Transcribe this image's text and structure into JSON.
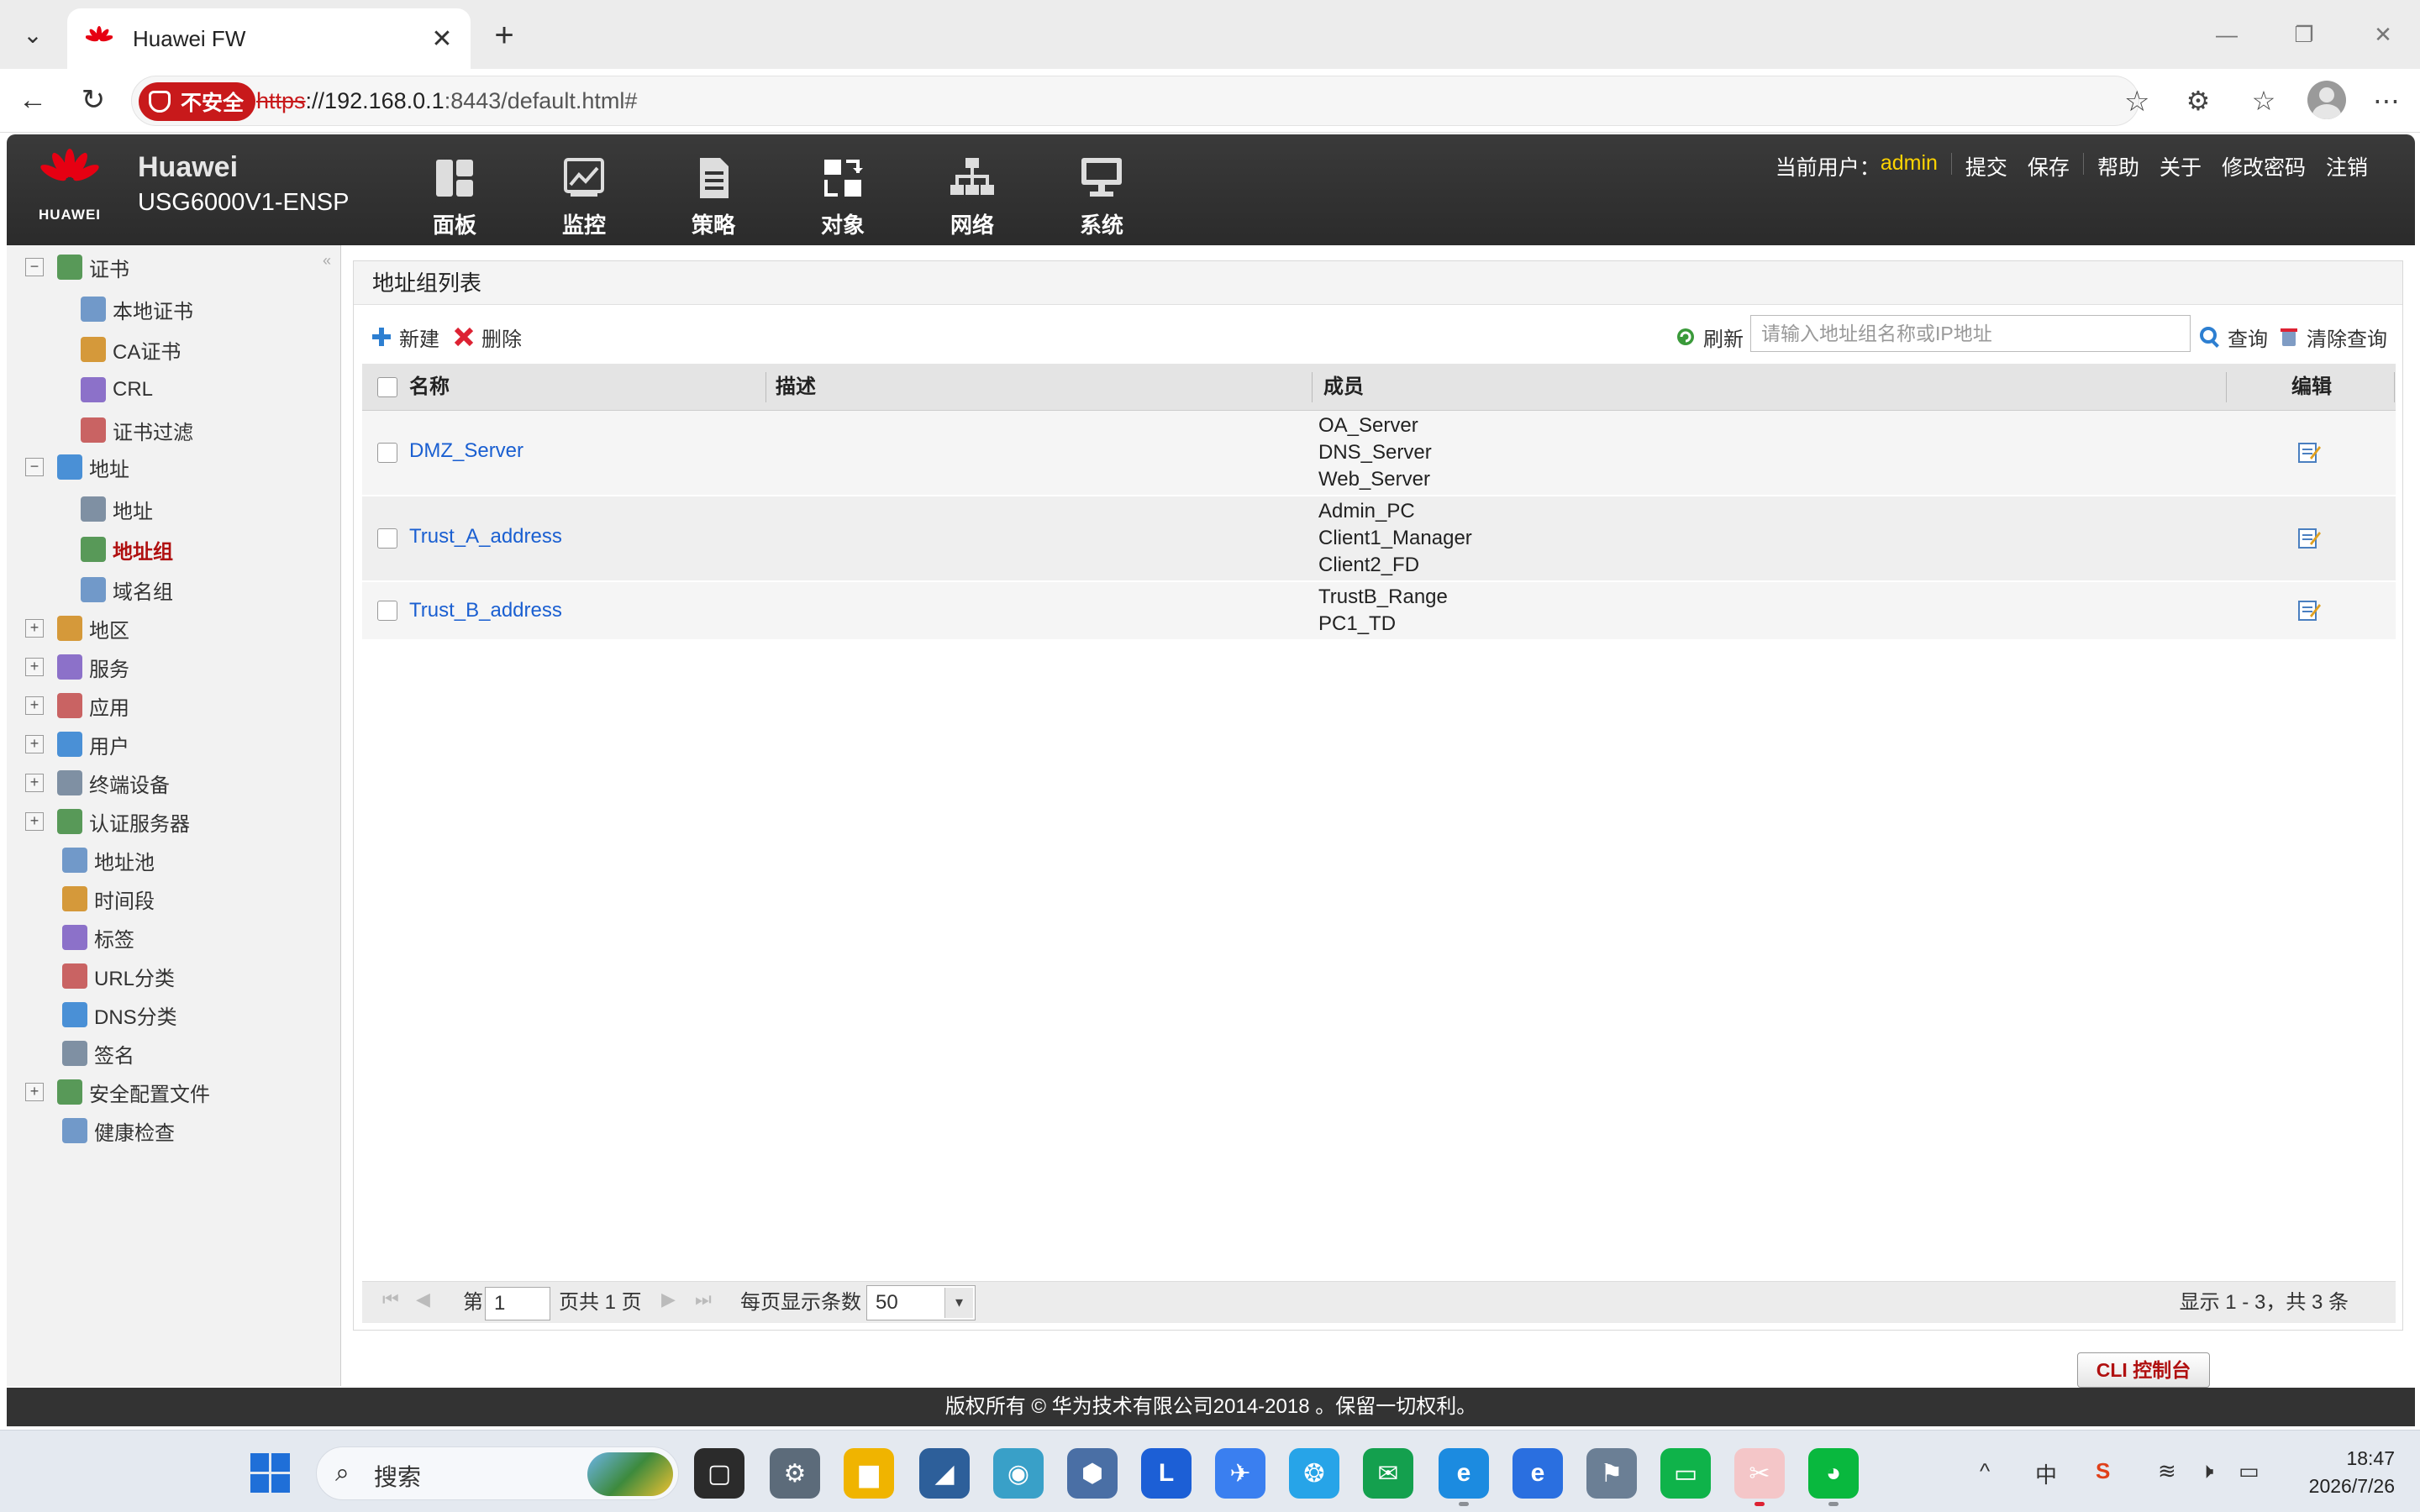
{
  "browser": {
    "tab_title": "Huawei FW",
    "insecure_label": "不安全",
    "url_scheme": "https",
    "url_host": "://192.168.0.1",
    "url_rest": ":8443/default.html#"
  },
  "app": {
    "logo_text": "HUAWEI",
    "brand_line1": "Huawei",
    "brand_line2": "USG6000V1-ENSP",
    "menu": [
      "面板",
      "监控",
      "策略",
      "对象",
      "网络",
      "系统"
    ],
    "active_menu": "对象",
    "current_user_label": "当前用户：",
    "current_user": "admin",
    "links": [
      "提交",
      "保存",
      "帮助",
      "关于",
      "修改密码",
      "注销"
    ]
  },
  "sidebar": {
    "items": [
      {
        "label": "证书",
        "toggle": "−"
      },
      {
        "label": "本地证书"
      },
      {
        "label": "CA证书"
      },
      {
        "label": "CRL"
      },
      {
        "label": "证书过滤"
      },
      {
        "label": "地址",
        "toggle": "−"
      },
      {
        "label": "地址"
      },
      {
        "label": "地址组",
        "selected": true
      },
      {
        "label": "域名组"
      },
      {
        "label": "地区",
        "toggle": "+"
      },
      {
        "label": "服务",
        "toggle": "+"
      },
      {
        "label": "应用",
        "toggle": "+"
      },
      {
        "label": "用户",
        "toggle": "+"
      },
      {
        "label": "终端设备",
        "toggle": "+"
      },
      {
        "label": "认证服务器",
        "toggle": "+"
      },
      {
        "label": "地址池"
      },
      {
        "label": "时间段"
      },
      {
        "label": "标签"
      },
      {
        "label": "URL分类"
      },
      {
        "label": "DNS分类"
      },
      {
        "label": "签名"
      },
      {
        "label": "安全配置文件",
        "toggle": "+"
      },
      {
        "label": "健康检查"
      }
    ]
  },
  "panel": {
    "title": "地址组列表",
    "new_label": "新建",
    "delete_label": "删除",
    "refresh_label": "刷新",
    "search_placeholder": "请输入地址组名称或IP地址",
    "query_label": "查询",
    "clear_label": "清除查询"
  },
  "grid": {
    "columns": [
      "名称",
      "描述",
      "成员",
      "编辑"
    ],
    "rows": [
      {
        "name": "DMZ_Server",
        "description": "",
        "members": [
          "OA_Server",
          "DNS_Server",
          "Web_Server"
        ]
      },
      {
        "name": "Trust_A_address",
        "description": "",
        "members": [
          "Admin_PC",
          "Client1_Manager",
          "Client2_FD"
        ]
      },
      {
        "name": "Trust_B_address",
        "description": "",
        "members": [
          "TrustB_Range",
          "PC1_TD"
        ]
      }
    ]
  },
  "pager": {
    "page_prefix": "第",
    "page_value": "1",
    "page_suffix": "页共 1 页",
    "per_page_label": "每页显示条数",
    "per_page_value": "50",
    "summary": "显示 1 - 3，共 3 条"
  },
  "cli_button": "CLI 控制台",
  "footer_text": "版权所有 © 华为技术有限公司2014-2018 。保留一切权利。",
  "taskbar": {
    "search_label": "搜索",
    "ime": "中",
    "time": "18:47",
    "date": "2026/7/26"
  }
}
